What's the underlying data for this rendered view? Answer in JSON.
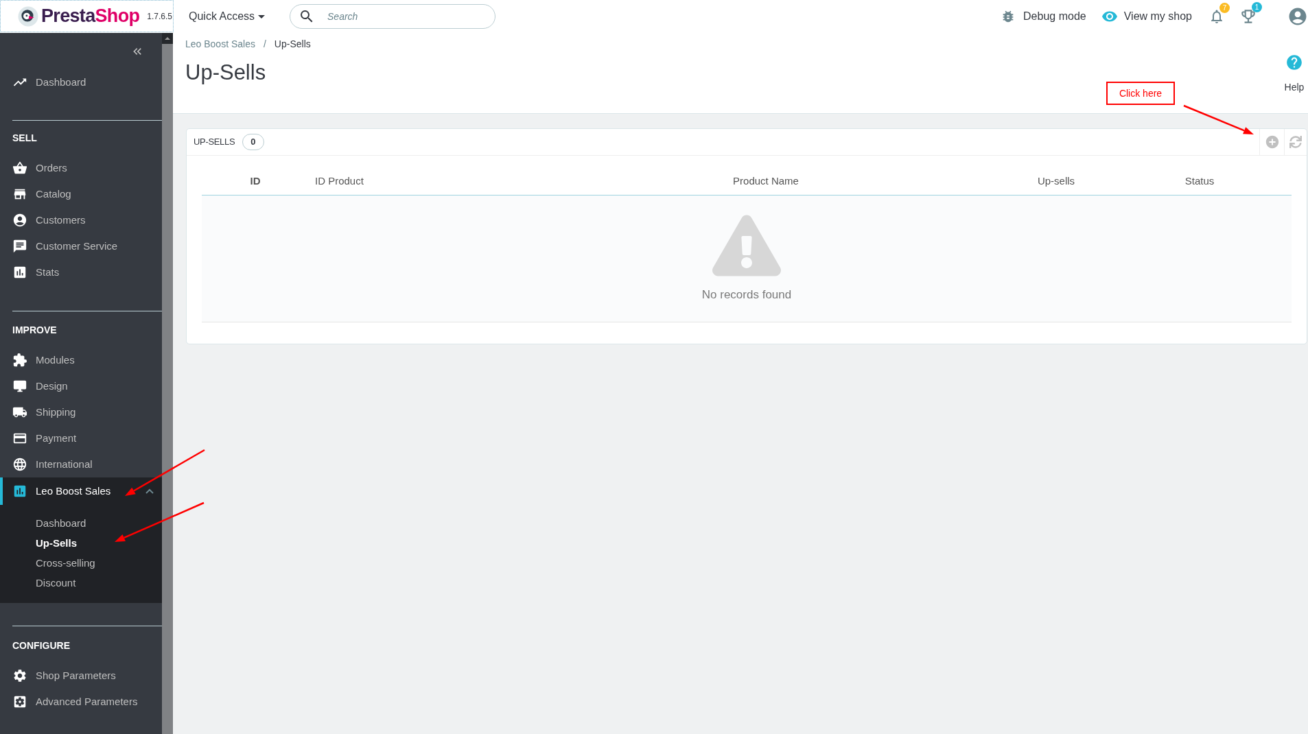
{
  "header": {
    "logo": {
      "name_start": "Presta",
      "name_end": "Shop"
    },
    "version": "1.7.6.5",
    "quick_access": {
      "label": "Quick Access"
    },
    "search": {
      "placeholder": "Search"
    },
    "debug_mode": {
      "label": "Debug mode"
    },
    "view_shop": {
      "label": "View my shop"
    },
    "notifications": {
      "count": "7"
    },
    "achievements": {
      "count": "1"
    }
  },
  "sidebar": {
    "sections": [
      {
        "items": [
          {
            "label": "Dashboard",
            "selected": false
          }
        ]
      },
      {
        "title": "SELL",
        "items": [
          {
            "label": "Orders",
            "selected": false
          },
          {
            "label": "Catalog",
            "selected": false
          },
          {
            "label": "Customers",
            "selected": false
          },
          {
            "label": "Customer Service",
            "selected": false
          },
          {
            "label": "Stats",
            "selected": false
          }
        ]
      },
      {
        "title": "IMPROVE",
        "items": [
          {
            "label": "Modules",
            "selected": false
          },
          {
            "label": "Design",
            "selected": false
          },
          {
            "label": "Shipping",
            "selected": false
          },
          {
            "label": "Payment",
            "selected": false
          },
          {
            "label": "International",
            "selected": false
          },
          {
            "label": "Leo Boost Sales",
            "selected": true,
            "expanded": true,
            "children": [
              {
                "label": "Dashboard",
                "selected": false
              },
              {
                "label": "Up-Sells",
                "selected": true
              },
              {
                "label": "Cross-selling",
                "selected": false
              },
              {
                "label": "Discount",
                "selected": false
              }
            ]
          }
        ]
      },
      {
        "title": "CONFIGURE",
        "items": [
          {
            "label": "Shop Parameters",
            "selected": false
          },
          {
            "label": "Advanced Parameters",
            "selected": false
          }
        ]
      }
    ]
  },
  "breadcrumb": {
    "items": [
      "Leo Boost Sales",
      "Up-Sells"
    ],
    "separator": "/"
  },
  "page_title": "Up-Sells",
  "help": {
    "label": "Help"
  },
  "annotation": {
    "label": "Click here"
  },
  "panel": {
    "title": "UP-SELLS",
    "count": "0",
    "table": {
      "columns": [
        {
          "label": "ID",
          "sorted": true
        },
        {
          "label": "ID Product",
          "sorted": false
        },
        {
          "label": "Product Name",
          "sorted": false
        },
        {
          "label": "Up-sells",
          "sorted": false
        },
        {
          "label": "Status",
          "sorted": false
        }
      ],
      "empty_message": "No records found"
    }
  }
}
